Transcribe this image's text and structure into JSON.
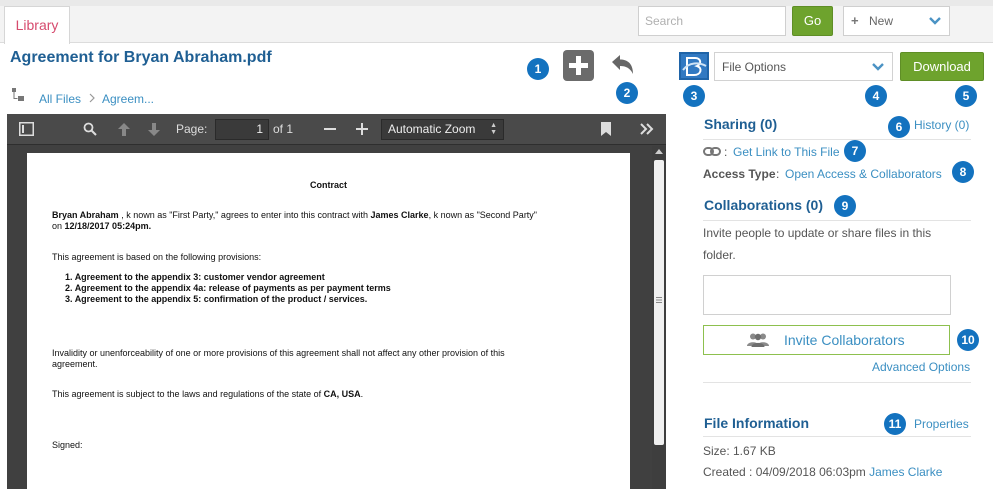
{
  "topbar": {
    "tab_library": "Library",
    "search_placeholder": "Search",
    "go_label": "Go",
    "new_label": "New"
  },
  "file": {
    "title": "Agreement for Bryan Abraham.pdf",
    "breadcrumb": [
      "All Files",
      "Agreem..."
    ]
  },
  "toolbar": {
    "file_options_label": "File Options",
    "download_label": "Download"
  },
  "badges": [
    "1",
    "2",
    "3",
    "4",
    "5",
    "6",
    "7",
    "8",
    "9",
    "10",
    "11"
  ],
  "viewer": {
    "page_label": "Page:",
    "page_value": "1",
    "page_of": "of 1",
    "zoom": "Automatic Zoom"
  },
  "document": {
    "heading": "Contract",
    "para1": {
      "party1": "Bryan Abraham",
      "t1": " , k nown as \"First Party,\" agrees to enter into this contract with ",
      "party2": "James Clarke",
      "t2": ", k nown as \"Second Party\"",
      "t3": "on ",
      "date": "12/18/2017 05:24pm."
    },
    "para2": "This agreement is based on the following provisions:",
    "provisions": [
      "Agreement to the appendix 3: customer vendor agreement",
      "Agreement to the appendix 4a: release of payments as per payment terms",
      "Agreement to the appendix 5: confirmation of the product / services."
    ],
    "para3_line1": "Invalidity or unenforceability of one or more provisions of this agreement shall not affect any other provision of this",
    "para3_line2": "agreement.",
    "para4_text": "This agreement is subject to the laws and regulations of the state of ",
    "para4_bold": "CA, USA",
    "para4_end": ".",
    "signed": "Signed:"
  },
  "sidebar": {
    "sharing_title": "Sharing (0)",
    "history_link": "History (0)",
    "get_link_prefix": ": ",
    "get_link": "Get Link to This File",
    "access_type_label": "Access Type",
    "access_sep": " : ",
    "access_type_value": "Open Access & Collaborators",
    "collab_title": "Collaborations (0)",
    "collab_desc_1": "Invite people to update or share files in this",
    "collab_desc_2": "folder.",
    "invite_label": "Invite Collaborators",
    "advanced_options": "Advanced Options",
    "file_info_title": "File Information",
    "properties_link": "Properties",
    "size_line": "Size: 1.67 KB",
    "created_prefix": "Created : 04/09/2018 06:03pm ",
    "created_by": "James Clarke"
  },
  "colors": {
    "accent_blue": "#1372bf",
    "title_blue": "#1f5f93",
    "link_blue": "#3b8fc2",
    "button_green": "#6ea32d",
    "tab_pink": "#d64b6e"
  }
}
